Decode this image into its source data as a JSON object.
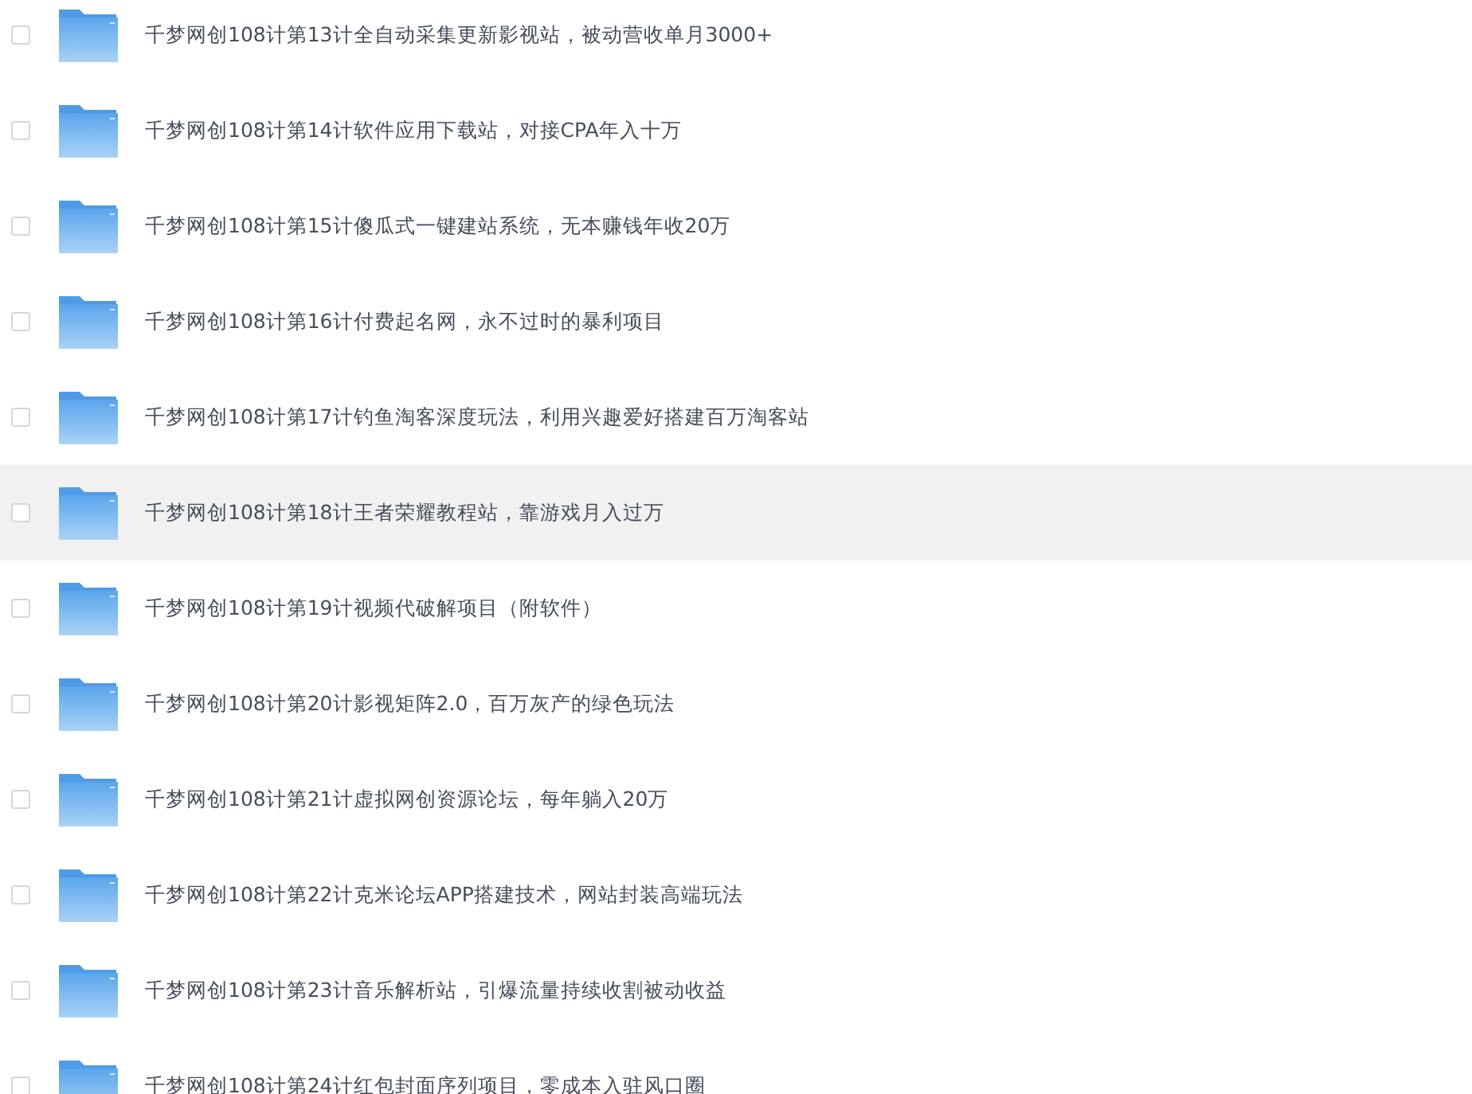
{
  "files": [
    {
      "name": "千梦网创108计第13计全自动采集更新影视站，被动营收单月3000+",
      "checked": false,
      "hovered": false
    },
    {
      "name": "千梦网创108计第14计软件应用下载站，对接CPA年入十万",
      "checked": false,
      "hovered": false
    },
    {
      "name": "千梦网创108计第15计傻瓜式一键建站系统，无本赚钱年收20万",
      "checked": false,
      "hovered": false
    },
    {
      "name": "千梦网创108计第16计付费起名网，永不过时的暴利项目",
      "checked": false,
      "hovered": false
    },
    {
      "name": "千梦网创108计第17计钓鱼淘客深度玩法，利用兴趣爱好搭建百万淘客站",
      "checked": false,
      "hovered": false
    },
    {
      "name": "千梦网创108计第18计王者荣耀教程站，靠游戏月入过万",
      "checked": false,
      "hovered": true
    },
    {
      "name": "千梦网创108计第19计视频代破解项目（附软件）",
      "checked": false,
      "hovered": false
    },
    {
      "name": "千梦网创108计第20计影视矩阵2.0，百万灰产的绿色玩法",
      "checked": false,
      "hovered": false
    },
    {
      "name": "千梦网创108计第21计虚拟网创资源论坛，每年躺入20万",
      "checked": false,
      "hovered": false
    },
    {
      "name": "千梦网创108计第22计克米论坛APP搭建技术，网站封装高端玩法",
      "checked": false,
      "hovered": false
    },
    {
      "name": "千梦网创108计第23计音乐解析站，引爆流量持续收割被动收益",
      "checked": false,
      "hovered": false
    },
    {
      "name": "千梦网创108计第24计红包封面序列项目，零成本入驻风口圈",
      "checked": false,
      "hovered": false
    }
  ]
}
